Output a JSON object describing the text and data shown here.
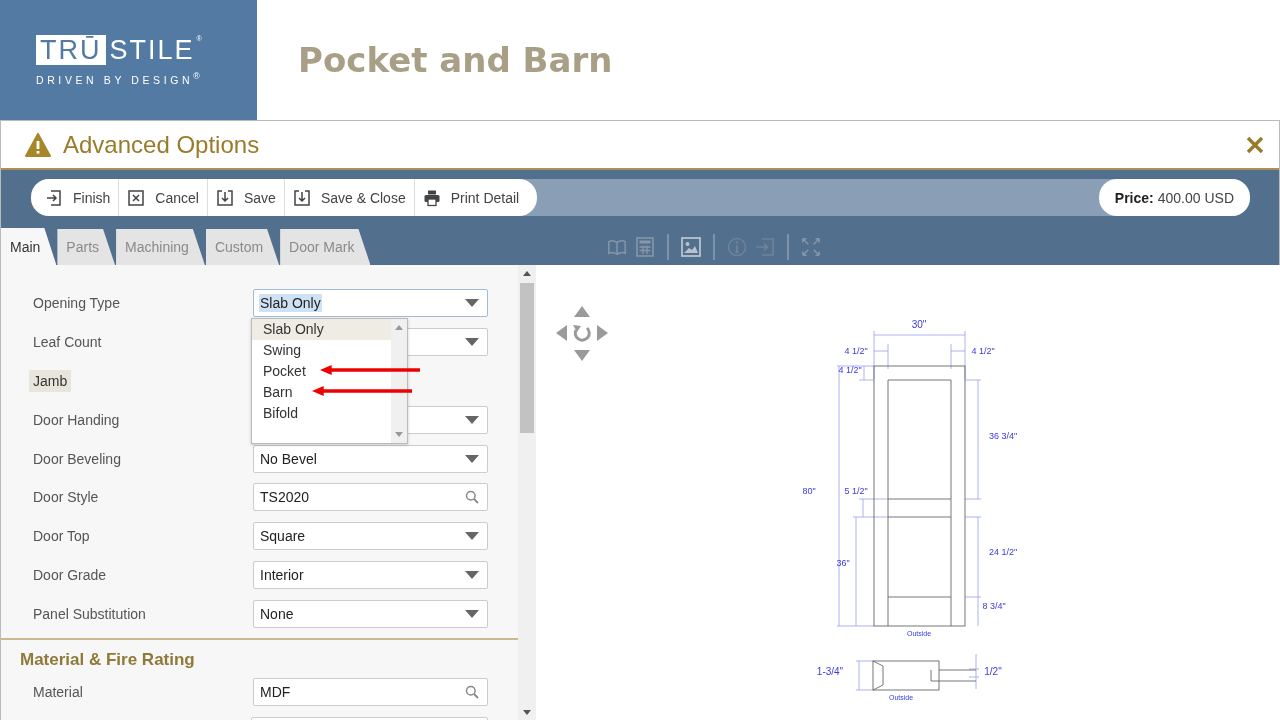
{
  "slide": {
    "logo": {
      "boxed": "TRŪ",
      "rest": "STILE",
      "mark": "®",
      "tagline": "DRIVEN BY DESIGN$^{®}$"
    },
    "title": "Pocket and Barn"
  },
  "dialog": {
    "title": "Advanced Options",
    "toolbar": [
      {
        "label": "Finish"
      },
      {
        "label": "Cancel"
      },
      {
        "label": "Save"
      },
      {
        "label": "Save & Close"
      },
      {
        "label": "Print Detail"
      }
    ],
    "price": {
      "label": "Price:",
      "value": "400.00 USD"
    },
    "tabs": [
      {
        "label": "Main",
        "selected": true
      },
      {
        "label": "Parts",
        "selected": false
      },
      {
        "label": "Machining",
        "selected": false
      },
      {
        "label": "Custom",
        "selected": false
      },
      {
        "label": "Door Mark",
        "selected": false
      }
    ],
    "form": {
      "rows": [
        {
          "label": "Opening Type",
          "kind": "select",
          "value": "Slab Only",
          "focused": true
        },
        {
          "label": "Leaf Count",
          "kind": "select",
          "focused": false
        },
        {
          "label": "Jamb",
          "kind": "toggle"
        },
        {
          "label": "Door Handing",
          "kind": "select",
          "focused": false
        },
        {
          "label": "Door Beveling",
          "kind": "select",
          "value": "No Bevel",
          "focused": false
        },
        {
          "label": "Door Style",
          "kind": "search",
          "value": "TS2020",
          "focused": false
        },
        {
          "label": "Door Top",
          "kind": "select",
          "value": "Square",
          "focused": false
        },
        {
          "label": "Door Grade",
          "kind": "select",
          "value": "Interior",
          "focused": false
        },
        {
          "label": "Panel Substitution",
          "kind": "select",
          "value": "None",
          "focused": false
        }
      ],
      "dropdown": [
        {
          "label": "Slab Only",
          "selected": true,
          "pointed": false
        },
        {
          "label": "Swing",
          "selected": false,
          "pointed": false
        },
        {
          "label": "Pocket",
          "selected": false,
          "pointed": true
        },
        {
          "label": "Barn",
          "selected": false,
          "pointed": true
        },
        {
          "label": "Bifold",
          "selected": false,
          "pointed": false
        }
      ],
      "section": {
        "title": "Material & Fire Rating",
        "rows": [
          {
            "label": "Material",
            "kind": "search",
            "value": "MDF",
            "focused": false
          }
        ]
      }
    },
    "drawing": {
      "labels": [
        "30\"",
        "4 1/2\"",
        "4 1/2\"",
        "4 1/2\"",
        "36 3/4\"",
        "80\"",
        "5 1/2\"",
        "36\"",
        "24 1/2\"",
        "8 3/4\"",
        "Outside",
        "1-3/4\"",
        "Outside",
        "1/2\""
      ]
    }
  }
}
